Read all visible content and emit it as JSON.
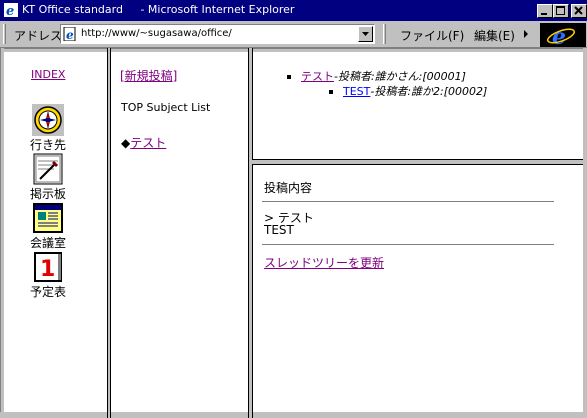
{
  "window": {
    "title": "KT Office standard     - Microsoft Internet Explorer"
  },
  "addressbar": {
    "label": "アドレス",
    "url": "http://www/~sugasawa/office/"
  },
  "menu": {
    "file": "ファイル(F)",
    "edit": "編集(E)"
  },
  "nav": {
    "index_label": "INDEX",
    "items": [
      {
        "label": "行き先",
        "icon": "compass-icon"
      },
      {
        "label": "掲示板",
        "icon": "bulletin-board-icon"
      },
      {
        "label": "会議室",
        "icon": "meeting-room-icon"
      },
      {
        "label": "予定表",
        "icon": "calendar-icon"
      }
    ],
    "calendar_day": "1"
  },
  "middle": {
    "new_post_link": "[新規投稿]",
    "list_title": "TOP Subject List",
    "topic_marker": "◆",
    "topic_link": "テスト"
  },
  "tree": {
    "items": [
      {
        "subject": "テスト",
        "meta": "-投稿者:誰かさん:[00001]"
      },
      {
        "subject": "TEST",
        "meta": "-投稿者:誰か2:[00002]"
      }
    ]
  },
  "post": {
    "heading": "投稿内容",
    "quoted_line": "> テスト",
    "body_line": "TEST",
    "refresh_link": "スレッドツリーを更新"
  },
  "colors": {
    "titlebar": "#000080",
    "link_visited": "#800080",
    "link": "#0000ff",
    "chrome": "#c0c0c0"
  }
}
